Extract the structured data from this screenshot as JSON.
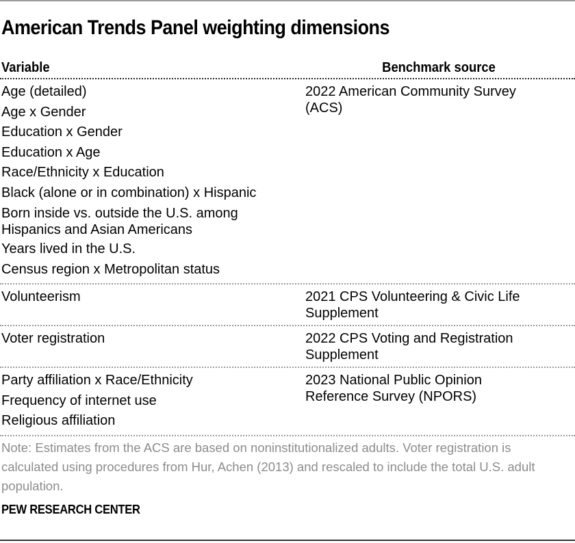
{
  "title": "American Trends Panel weighting dimensions",
  "table": {
    "headers": {
      "variable": "Variable",
      "source": "Benchmark source"
    },
    "groups": [
      {
        "variables": [
          "Age (detailed)",
          "Age x Gender",
          "Education x Gender",
          "Education x Age",
          "Race/Ethnicity x Education",
          "Black (alone or in combination) x Hispanic",
          "Born inside vs. outside the U.S. among Hispanics and Asian Americans",
          "Years lived in the U.S.",
          "Census region x Metropolitan status"
        ],
        "source": "2022 American Community Survey (ACS)"
      },
      {
        "variables": [
          "Volunteerism"
        ],
        "source": "2021 CPS Volunteering & Civic Life Supplement"
      },
      {
        "variables": [
          "Voter registration"
        ],
        "source": "2022 CPS Voting and Registration Supplement"
      },
      {
        "variables": [
          "Party affiliation x Race/Ethnicity",
          "Frequency of internet use",
          "Religious affiliation"
        ],
        "source": "2023 National Public Opinion Reference Survey (NPORS)"
      }
    ]
  },
  "note": "Note: Estimates from the ACS are based on noninstitutionalized adults. Voter registration is calculated using procedures from Hur, Achen (2013) and rescaled to include the total U.S. adult population.",
  "footer": "PEW RESEARCH CENTER"
}
